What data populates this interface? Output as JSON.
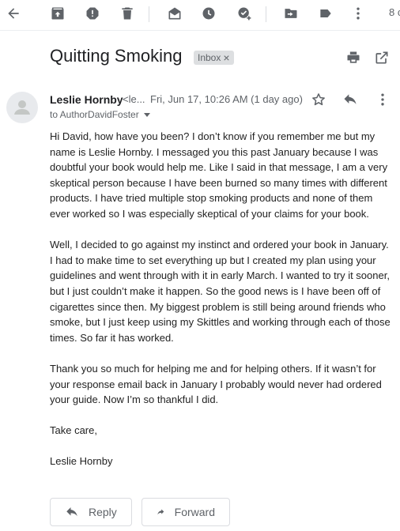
{
  "toolbar": {
    "icons": [
      "back-icon",
      "archive-icon",
      "report-spam-icon",
      "delete-icon",
      "mark-unread-icon",
      "snooze-icon",
      "add-to-tasks-icon",
      "move-to-icon",
      "label-icon",
      "more-icon"
    ],
    "page_count": "8 c"
  },
  "email": {
    "subject": "Quitting Smoking",
    "label": "Inbox",
    "label_remove": "×",
    "sender_name": "Leslie Hornby",
    "sender_email": "<le...",
    "date": "Fri, Jun 17, 10:26 AM (1 day ago)",
    "to": "to AuthorDavidFoster",
    "body": [
      "Hi David, how have you been? I don’t know if you remember me but my name is Leslie Hornby. I messaged you this past January because I was doubtful your book would help me. Like I said in that message, I am a very skeptical person because I have been burned so many times with different products. I have tried multiple stop smoking products and none of them ever worked so I was especially skeptical of your claims for your book.",
      "Well, I decided to go against my instinct and ordered your book in January. I had to make time to set everything up but I created my plan using your guidelines and went through with it in early March. I wanted to try it sooner, but I just couldn’t make it happen. So the good news is I have been off of cigarettes since then. My biggest problem is still being around friends who smoke, but I just keep using my Skittles and working through each of those times. So far it has worked.",
      "Thank you so much for helping me and for helping others. If it wasn’t for your response email back in January I probably would never had ordered your guide. Now I’m so thankful I did.",
      "Take care,",
      "Leslie Hornby"
    ]
  },
  "actions": {
    "reply_label": "Reply",
    "forward_label": "Forward"
  },
  "colors": {
    "icon_gray": "#5f6368",
    "chip_bg": "#dddfe1",
    "border": "#dadce0"
  }
}
